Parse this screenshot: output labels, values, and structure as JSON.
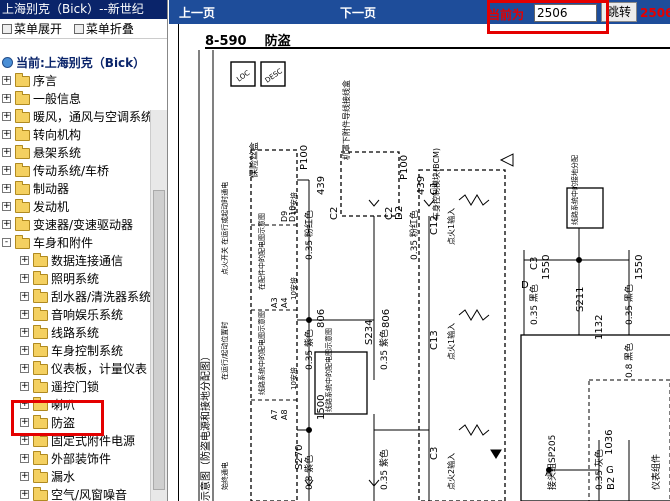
{
  "app_title": "上海别克（Bick）--新世纪",
  "toolbar": {
    "expand": "菜单展开",
    "collapse": "菜单折叠"
  },
  "current": "当前:上海别克（Bick）",
  "tree": [
    {
      "label": "序言",
      "level": 0,
      "sign": "+"
    },
    {
      "label": "一般信息",
      "level": 0,
      "sign": "+"
    },
    {
      "label": "暖风，通风与空调系统",
      "level": 0,
      "sign": "+"
    },
    {
      "label": "转向机构",
      "level": 0,
      "sign": "+"
    },
    {
      "label": "悬架系统",
      "level": 0,
      "sign": "+"
    },
    {
      "label": "传动系统/车桥",
      "level": 0,
      "sign": "+"
    },
    {
      "label": "制动器",
      "level": 0,
      "sign": "+"
    },
    {
      "label": "发动机",
      "level": 0,
      "sign": "+"
    },
    {
      "label": "变速器/变速驱动器",
      "level": 0,
      "sign": "+"
    },
    {
      "label": "车身和附件",
      "level": 0,
      "sign": "-"
    },
    {
      "label": "数据连接通信",
      "level": 1,
      "sign": "+"
    },
    {
      "label": "照明系统",
      "level": 1,
      "sign": "+"
    },
    {
      "label": "刮水器/清洗器系统",
      "level": 1,
      "sign": "+"
    },
    {
      "label": "音响娱乐系统",
      "level": 1,
      "sign": "+"
    },
    {
      "label": "线路系统",
      "level": 1,
      "sign": "+"
    },
    {
      "label": "车身控制系统",
      "level": 1,
      "sign": "+"
    },
    {
      "label": "仪表板，计量仪表",
      "level": 1,
      "sign": "+"
    },
    {
      "label": "遥控门锁",
      "level": 1,
      "sign": "+"
    },
    {
      "label": "喇叭",
      "level": 1,
      "sign": "+"
    },
    {
      "label": "防盗",
      "level": 1,
      "sign": "+"
    },
    {
      "label": "固定式附件电源",
      "level": 1,
      "sign": "+"
    },
    {
      "label": "外部装饰件",
      "level": 1,
      "sign": "+"
    },
    {
      "label": "漏水",
      "level": 1,
      "sign": "+"
    },
    {
      "label": "空气/风窗噪音",
      "level": 1,
      "sign": "+"
    }
  ],
  "nav": {
    "prev": "上一页",
    "next": "下一页",
    "current_label": "当前为",
    "page_value": "2506",
    "go": "跳转",
    "page_number": "2506"
  },
  "doc": {
    "section": "8-590",
    "title": "防盗",
    "labels": {
      "fuse_box": "保险丝盒",
      "engine_bay": "机罩下附件导线接线盒",
      "bcm": "车身控制模块(BCM)",
      "cfg_a": "在配件中的配电图示意图",
      "cfg_b": "线路系统中的配电图示意图",
      "cfg_c": "线路系统中的配电图示意图",
      "cfg_d": "线路系统中的接地分配",
      "side_caption": "示意图（防盗电源和接地分配图）",
      "p100": "P100",
      "s234": "S234",
      "s270": "S270",
      "s211": "S211",
      "sp205": "接头组SP205",
      "wire_439_a": "0.35 粉红色",
      "wire_439_b": "0.35 粉红色",
      "wire_806_a": "0.35 紫色",
      "wire_806_b": "0.35 紫色",
      "wire_1500": "0.8 紫色",
      "wire_1500_b": "0.35 紫色",
      "wire_1550_a": "0.35 黑色",
      "wire_1550_b": "0.35 黑色",
      "wire_1132": "0.8 黑色",
      "wire_1036": "0.35 灰色",
      "c2": "C2",
      "c1": "C1",
      "c12": "C12",
      "c3": "C3",
      "c13": "C13",
      "d2": "D2",
      "d10": "D10",
      "d9": "D9",
      "a3": "A3",
      "a4": "A4",
      "a7": "A7",
      "a8": "A8",
      "b2": "B2",
      "n439": "439",
      "n806": "806",
      "n1500": "1500",
      "n1550": "1550",
      "n1132": "1132",
      "n1036": "1036",
      "loc": "LOC",
      "desc": "DESC",
      "fuse_10a": "10安培",
      "input_a": "点火1输入",
      "input_b": "点火1输入",
      "input_c": "点火2输入",
      "ign_on": "点火开关 在运行或起动时通电",
      "hot_run": "在运行/起动位置时",
      "always_hot": "始终通电",
      "accessory": "附件位置",
      "ctrl": "仪表组件",
      "d_c3": "D",
      "g": "G",
      "a_end": "A"
    }
  }
}
